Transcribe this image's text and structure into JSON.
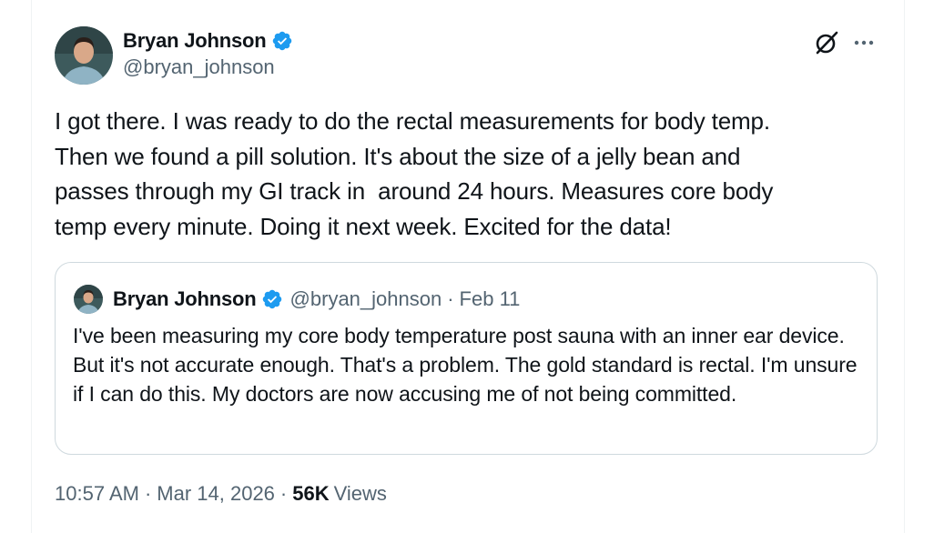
{
  "tweet": {
    "author": {
      "name": "Bryan Johnson",
      "handle": "@bryan_johnson",
      "verified": true
    },
    "text": "I got there. I was ready to do the rectal measurements for body temp.\nThen we found a pill solution. It's about the size of a jelly bean and\npasses through my GI track in  around 24 hours. Measures core body\ntemp every minute. Doing it next week. Excited for the data!",
    "quote": {
      "author_name": "Bryan Johnson",
      "handle": "@bryan_johnson",
      "separator": "·",
      "date": "Feb 11",
      "text": "I've been measuring my core body temperature post sauna with an inner ear device. But it's not accurate enough. That's a problem. The gold standard is rectal. I'm unsure if I can do this. My doctors are now accusing me of not being committed."
    },
    "meta": {
      "time": "10:57 AM",
      "separator": "·",
      "date": "Mar 14, 2026",
      "views_count": "56K",
      "views_label": "Views"
    }
  },
  "icons": {
    "verified": "verified-badge-icon",
    "grok": "grok-icon",
    "more": "more-options-icon"
  },
  "colors": {
    "text_primary": "#0f1419",
    "text_secondary": "#536471",
    "verified_blue": "#1d9bf0",
    "border": "#cfd9de"
  }
}
